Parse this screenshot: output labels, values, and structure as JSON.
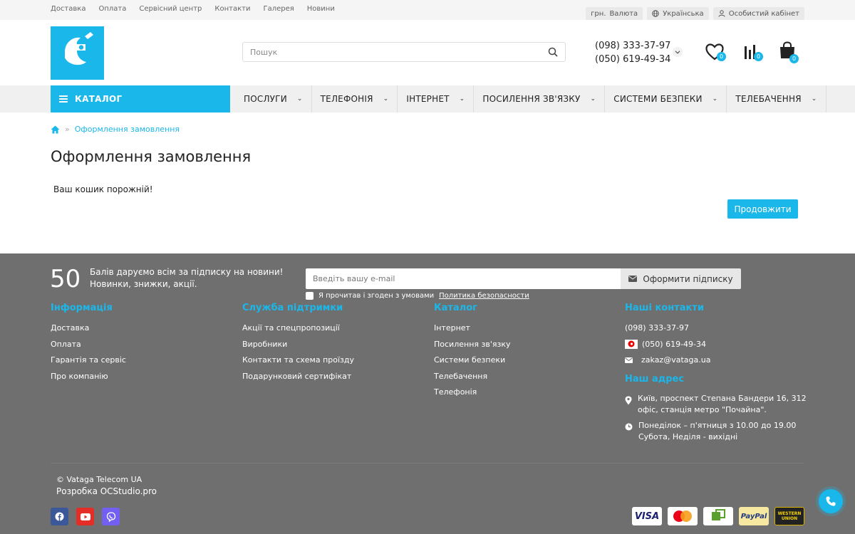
{
  "topbar": {
    "links": [
      "Доставка",
      "Оплата",
      "Сервісний центр",
      "Контакти",
      "Галерея",
      "Новини"
    ],
    "currency_code": "грн.",
    "currency_label": "Валюта",
    "language": "Українська",
    "account": "Особистий кабінет"
  },
  "header": {
    "search_placeholder": "Пошук",
    "phone1": "(098) 333-37-97",
    "phone2": "(050) 619-49-34",
    "wishlist_count": "0",
    "compare_count": "0",
    "cart_count": "0"
  },
  "nav": {
    "catalog_label": "КАТАЛОГ",
    "items": [
      "ПОСЛУГИ",
      "ТЕЛЕФОНІЯ",
      "ІНТЕРНЕТ",
      "ПОСИЛЕННЯ ЗВ'ЯЗКУ",
      "СИСТЕМИ БЕЗПЕКИ",
      "ТЕЛЕБАЧЕННЯ"
    ]
  },
  "main": {
    "breadcrumb_current": "Оформлення замовлення",
    "title": "Оформлення замовлення",
    "empty_text": "Ваш кошик порожній!",
    "continue_label": "Продовжити"
  },
  "footer": {
    "subscribe": {
      "points": "50",
      "line1": "Балів даруємо всім за підписку на новини!",
      "line2": "Новинки, знижки, акції.",
      "email_placeholder": "Введіть вашу e-mail",
      "button_label": "Оформити підписку",
      "agree_text": "Я прочитав і згоден з умовами",
      "policy_link": "Политика безопасности"
    },
    "info": {
      "heading": "Інформація",
      "items": [
        "Доставка",
        "Оплата",
        "Гарантія та сервіс",
        "Про компанію"
      ]
    },
    "support": {
      "heading": "Служба підтримки",
      "items": [
        "Акції та спецпропозиції",
        "Виробники",
        "Контакти та схема проїзду",
        "Подарунковий сертифікат"
      ]
    },
    "catalog": {
      "heading": "Каталог",
      "items": [
        "Інтернет",
        "Посилення зв'язку",
        "Системи безпеки",
        "Телебачення",
        "Телефонія"
      ]
    },
    "contacts": {
      "heading": "Наші контакти",
      "phone1": "(098) 333-37-97",
      "phone2": "(050) 619-49-34",
      "email": "zakaz@vataga.ua",
      "address_heading": "Наш адрес",
      "address_line1": "Київ, проспект Степана Бандери 16, 312",
      "address_line2": "офіс, станція метро \"Почайна\".",
      "hours_line1": "Понеділок – п'ятниця з 10.00 до 19.00",
      "hours_line2": "Субота, Неділя - вихідні"
    },
    "copyright": "© Vataga Telecom UA",
    "developer": "Розробка OCStudio.pro",
    "payments": [
      "VISA",
      "PayPal",
      "WESTERN UNION"
    ]
  },
  "colors": {
    "accent": "#1ab7ea",
    "footer_bg": "#6f6f6f",
    "nav_bg": "#f0f0f0"
  }
}
